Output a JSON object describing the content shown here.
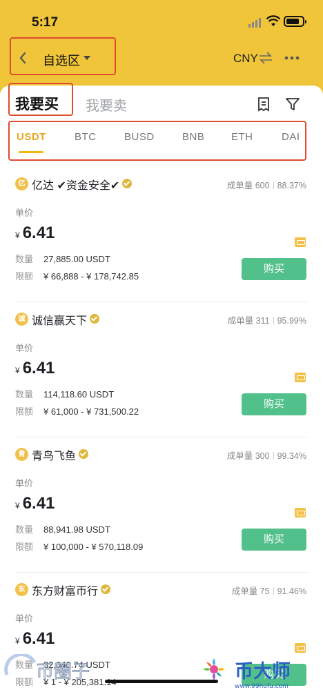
{
  "status_bar": {
    "time": "5:17"
  },
  "nav": {
    "title": "自选区",
    "currency": "CNY"
  },
  "trade_tabs": {
    "buy": "我要买",
    "sell": "我要卖"
  },
  "coins": [
    "USDT",
    "BTC",
    "BUSD",
    "BNB",
    "ETH",
    "DAI"
  ],
  "active_coin": "USDT",
  "labels": {
    "price": "单价",
    "quantity": "数量",
    "limit": "限额",
    "currency_symbol": "¥",
    "buy_button": "购买"
  },
  "ads": [
    {
      "avatar": "亿",
      "name": "亿达 ✔资金安全✔",
      "volume": "成单量 600",
      "rate": "88.37%",
      "price": "6.41",
      "quantity": "27,885.00 USDT",
      "limit": "¥ 66,888 - ¥ 178,742.85"
    },
    {
      "avatar": "诚",
      "name": "诚信赢天下",
      "volume": "成单量 311",
      "rate": "95.99%",
      "price": "6.41",
      "quantity": "114,118.60 USDT",
      "limit": "¥ 61,000 - ¥ 731,500.22"
    },
    {
      "avatar": "青",
      "name": "青鸟飞鱼",
      "volume": "成单量 300",
      "rate": "99.34%",
      "price": "6.41",
      "quantity": "88,941.98 USDT",
      "limit": "¥ 100,000 - ¥ 570,118.09"
    },
    {
      "avatar": "东",
      "name": "东方财富币行",
      "volume": "成单量 75",
      "rate": "91.46%",
      "price": "6.41",
      "quantity": "32,040.74 USDT",
      "limit": "¥ 1 - ¥ 205,381.14"
    }
  ],
  "watermarks": {
    "left": "币圈子",
    "right": "币大师",
    "right_url": "www.99hufu.com"
  },
  "colors": {
    "header_bg": "#f0c53a",
    "accent": "#f0b90b",
    "buy_green": "#52c08a",
    "highlight_box": "#e04a2e"
  }
}
